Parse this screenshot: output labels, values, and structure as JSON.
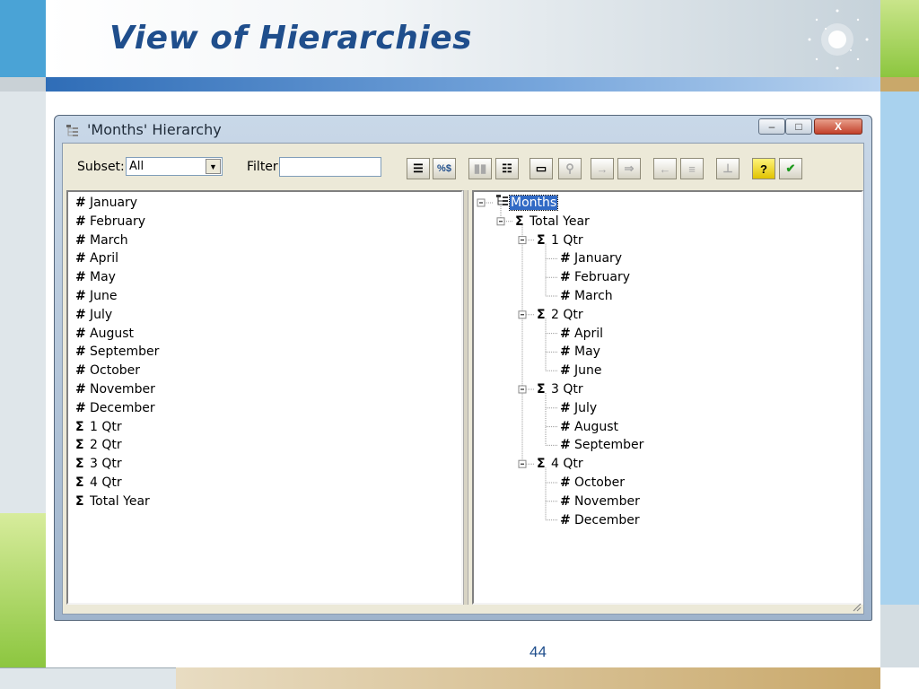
{
  "slide": {
    "title": "View of Hierarchies",
    "page_number": "44"
  },
  "window": {
    "title": "'Months' Hierarchy",
    "controls": {
      "minimize": "–",
      "maximize": "□",
      "close": "X"
    }
  },
  "toolbar": {
    "subset_label": "Subset:",
    "subset_value": "All",
    "filter_label": "Filter:",
    "filter_value": "",
    "buttons": [
      {
        "icon": "hierarchy-icon",
        "glyph": "☰",
        "enabled": true
      },
      {
        "icon": "percent-dollar-icon",
        "glyph": "%$",
        "enabled": true
      },
      {
        "icon": "expand-icon",
        "glyph": "▮▮",
        "enabled": false
      },
      {
        "icon": "grid-icon",
        "glyph": "☷",
        "enabled": true
      },
      {
        "icon": "folder-icon",
        "glyph": "▭",
        "enabled": true
      },
      {
        "icon": "key-icon",
        "glyph": "⚲",
        "enabled": false
      },
      {
        "icon": "arrow-right-icon",
        "glyph": "→",
        "enabled": false
      },
      {
        "icon": "double-arrow-icon",
        "glyph": "⇒",
        "enabled": false
      },
      {
        "icon": "insert-icon",
        "glyph": "←",
        "enabled": false
      },
      {
        "icon": "consolidate-icon",
        "glyph": "≡",
        "enabled": false
      },
      {
        "icon": "balance-icon",
        "glyph": "⊥",
        "enabled": false
      },
      {
        "icon": "help-icon",
        "glyph": "?",
        "enabled": true
      },
      {
        "icon": "check-icon",
        "glyph": "✔",
        "enabled": true
      }
    ]
  },
  "left_list": [
    {
      "sym": "#",
      "label": "January"
    },
    {
      "sym": "#",
      "label": "February"
    },
    {
      "sym": "#",
      "label": "March"
    },
    {
      "sym": "#",
      "label": "April"
    },
    {
      "sym": "#",
      "label": "May"
    },
    {
      "sym": "#",
      "label": "June"
    },
    {
      "sym": "#",
      "label": "July"
    },
    {
      "sym": "#",
      "label": "August"
    },
    {
      "sym": "#",
      "label": "September"
    },
    {
      "sym": "#",
      "label": "October"
    },
    {
      "sym": "#",
      "label": "November"
    },
    {
      "sym": "#",
      "label": "December"
    },
    {
      "sym": "Σ",
      "label": "1 Qtr"
    },
    {
      "sym": "Σ",
      "label": "2 Qtr"
    },
    {
      "sym": "Σ",
      "label": "3 Qtr"
    },
    {
      "sym": "Σ",
      "label": "4 Qtr"
    },
    {
      "sym": "Σ",
      "label": "Total Year"
    }
  ],
  "tree": [
    {
      "level": 0,
      "sym": "",
      "label": "Months",
      "selected": true
    },
    {
      "level": 1,
      "sym": "Σ",
      "label": "Total Year"
    },
    {
      "level": 2,
      "sym": "Σ",
      "label": "1 Qtr"
    },
    {
      "level": 3,
      "sym": "#",
      "label": "January"
    },
    {
      "level": 3,
      "sym": "#",
      "label": "February"
    },
    {
      "level": 3,
      "sym": "#",
      "label": "March"
    },
    {
      "level": 2,
      "sym": "Σ",
      "label": "2 Qtr"
    },
    {
      "level": 3,
      "sym": "#",
      "label": "April"
    },
    {
      "level": 3,
      "sym": "#",
      "label": "May"
    },
    {
      "level": 3,
      "sym": "#",
      "label": "June"
    },
    {
      "level": 2,
      "sym": "Σ",
      "label": "3 Qtr"
    },
    {
      "level": 3,
      "sym": "#",
      "label": "July"
    },
    {
      "level": 3,
      "sym": "#",
      "label": "August"
    },
    {
      "level": 3,
      "sym": "#",
      "label": "September"
    },
    {
      "level": 2,
      "sym": "Σ",
      "label": "4 Qtr"
    },
    {
      "level": 3,
      "sym": "#",
      "label": "October"
    },
    {
      "level": 3,
      "sym": "#",
      "label": "November"
    },
    {
      "level": 3,
      "sym": "#",
      "label": "December"
    }
  ],
  "colors": {
    "title": "#1f4e8c",
    "accent_blue": "#4f86c6",
    "accent_green": "#8cc63f",
    "accent_tan": "#c9a86a",
    "selection": "#316ac5"
  }
}
